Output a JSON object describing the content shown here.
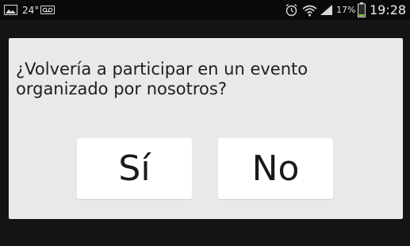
{
  "status_bar": {
    "temperature": "24°",
    "battery_percent": "17%",
    "time": "19:28",
    "icons": [
      "image-icon",
      "voicemail-icon",
      "alarm-icon",
      "wifi-icon",
      "signal-icon",
      "battery-icon"
    ]
  },
  "dialog": {
    "question": "¿Volvería a participar en un evento organizado por nosotros?",
    "yes_label": "Sí",
    "no_label": "No"
  },
  "colors": {
    "dialog_bg": "#e9e9e9",
    "button_bg": "#ffffff",
    "status_bar_bg": "#0a0a0a",
    "battery_level": "#8bc34a"
  }
}
